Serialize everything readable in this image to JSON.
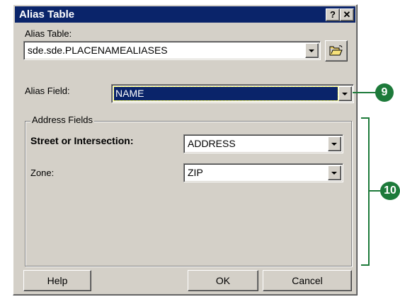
{
  "window": {
    "title": "Alias Table",
    "help_glyph": "?",
    "close_glyph": "✕"
  },
  "alias_table": {
    "label": "Alias Table:",
    "value": "sde.sde.PLACENAMEALIASES"
  },
  "alias_field": {
    "label": "Alias Field:",
    "value": "NAME"
  },
  "address_fields": {
    "legend": "Address Fields",
    "street": {
      "label": "Street or Intersection:",
      "value": "ADDRESS"
    },
    "zone": {
      "label": "Zone:",
      "value": "ZIP"
    }
  },
  "buttons": {
    "help": "Help",
    "ok": "OK",
    "cancel": "Cancel"
  },
  "callouts": {
    "one": "9",
    "two": "10"
  },
  "colors": {
    "titlebar": "#0a246a",
    "selection": "#0a246a",
    "callout": "#1d7a3a",
    "dialog_bg": "#d4d0c8"
  }
}
